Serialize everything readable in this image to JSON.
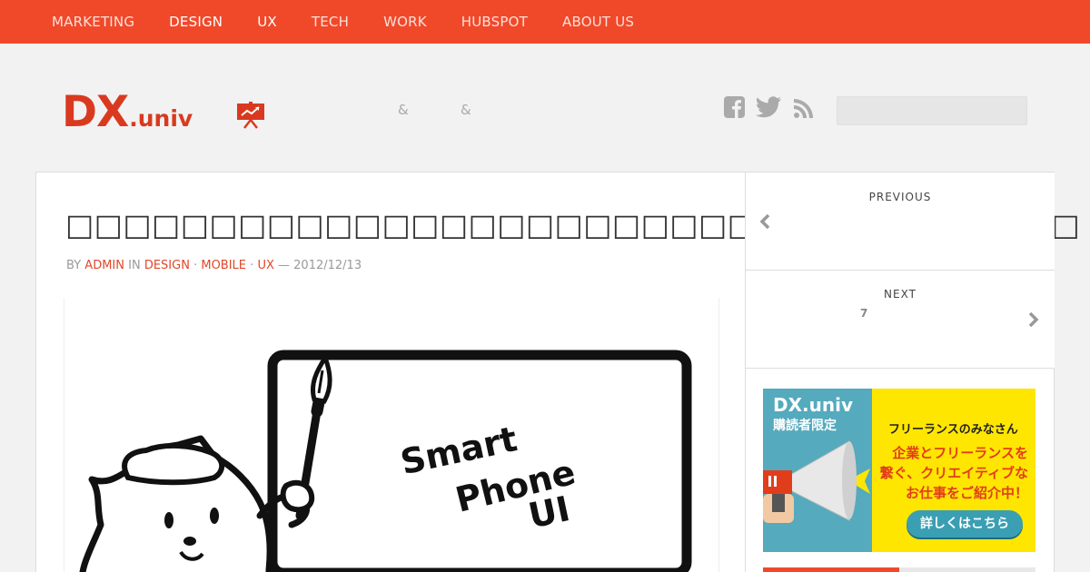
{
  "nav": {
    "items": [
      {
        "label": "MARKETING",
        "active": false
      },
      {
        "label": "DESIGN",
        "active": true
      },
      {
        "label": "UX",
        "active": true
      },
      {
        "label": "TECH",
        "active": false
      },
      {
        "label": "WORK",
        "active": false
      },
      {
        "label": "HUBSPOT",
        "active": false
      },
      {
        "label": "ABOUT US",
        "active": false
      }
    ]
  },
  "header": {
    "logo_main": "DX",
    "logo_sub": ".univ",
    "tagline_amp1": "&",
    "tagline_amp2": "&",
    "social_icons": [
      "facebook-icon",
      "twitter-icon",
      "rss-icon"
    ]
  },
  "post": {
    "title": "□□□□□□□□□□□□□□□□□□□□□□□□□□□□□□UI□□□□",
    "meta_by": "BY",
    "author": "ADMIN",
    "meta_in": "IN",
    "categories": [
      "DESIGN",
      "MOBILE",
      "UX"
    ],
    "date": "2012/12/13",
    "image_text": [
      "Smart",
      "Phone",
      "UI"
    ]
  },
  "sidebar": {
    "previous_label": "PREVIOUS",
    "next_label": "NEXT",
    "next_number": "7"
  },
  "ad": {
    "brand": "DX.univ",
    "sub": "購読者限定",
    "headline": "フリーランスのみなさん",
    "body_lines": [
      "企業とフリーランスを",
      "繋ぐ、クリエイティブな",
      "お仕事をご紹介中！"
    ],
    "button": "詳しくはこちら"
  },
  "colors": {
    "accent": "#f0492a",
    "logo": "#d93a1f",
    "ad_yellow": "#ffe600",
    "ad_teal": "#55aabd"
  }
}
